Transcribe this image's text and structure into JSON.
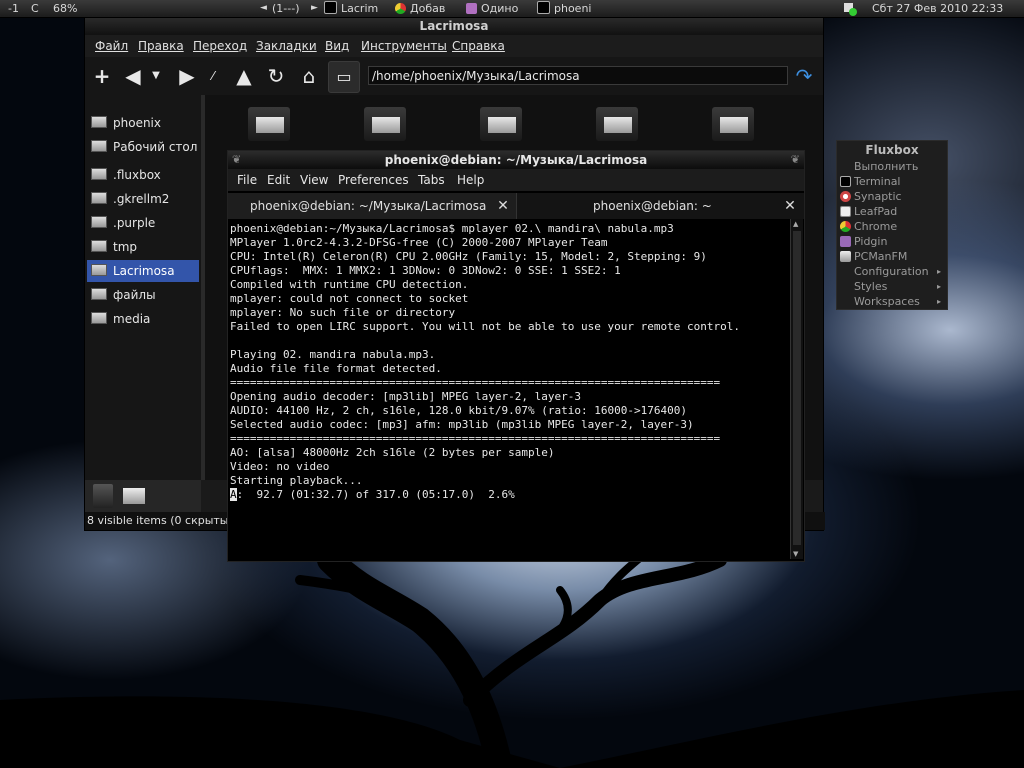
{
  "colors": {
    "selection": "#3355aa",
    "accent": "#3d8fe0",
    "terminal_bg": "#000000"
  },
  "top_panel": {
    "workspace_num": "-1",
    "workspace_letter": "C",
    "cpu_percent": "68%",
    "pager": "(1---)",
    "tasks": [
      "Lacrim",
      "Добав",
      "Одино",
      "phoeni"
    ],
    "clock": "Сбт 27 Фев 2010 22:33"
  },
  "file_manager": {
    "title": "Lacrimosa",
    "menu": [
      "Файл",
      "Правка",
      "Переход",
      "Закладки",
      "Вид",
      "Инструменты",
      "Справка"
    ],
    "toolbar_icons": [
      "new-tab-icon",
      "back-icon",
      "dropdown-icon",
      "forward-icon",
      "up-icon",
      "reload-icon",
      "home-icon",
      "folder-icon",
      "go-icon"
    ],
    "path": "/home/phoenix/Музыка/Lacrimosa",
    "sidebar": [
      {
        "label": "phoenix"
      },
      {
        "label": "Рабочий стол"
      },
      {
        "label": ".fluxbox"
      },
      {
        "label": ".gkrellm2"
      },
      {
        "label": ".purple"
      },
      {
        "label": "tmp"
      },
      {
        "label": "Lacrimosa",
        "selected": true
      },
      {
        "label": "файлы"
      },
      {
        "label": "media"
      }
    ],
    "status": "8 visible items (0 скрыты"
  },
  "terminal": {
    "title": "phoenix@debian: ~/Музыка/Lacrimosa",
    "menu": [
      "File",
      "Edit",
      "View",
      "Preferences",
      "Tabs",
      "Help"
    ],
    "tabs": [
      "phoenix@debian: ~/Музыка/Lacrimosa",
      "phoenix@debian: ~"
    ],
    "lines": [
      "phoenix@debian:~/Музыка/Lacrimosa$ mplayer 02.\\ mandira\\ nabula.mp3",
      "MPlayer 1.0rc2-4.3.2-DFSG-free (C) 2000-2007 MPlayer Team",
      "CPU: Intel(R) Celeron(R) CPU 2.00GHz (Family: 15, Model: 2, Stepping: 9)",
      "CPUflags:  MMX: 1 MMX2: 1 3DNow: 0 3DNow2: 0 SSE: 1 SSE2: 1",
      "Compiled with runtime CPU detection.",
      "mplayer: could not connect to socket",
      "mplayer: No such file or directory",
      "Failed to open LIRC support. You will not be able to use your remote control.",
      "",
      "Playing 02. mandira nabula.mp3.",
      "Audio file file format detected.",
      "==========================================================================",
      "Opening audio decoder: [mp3lib] MPEG layer-2, layer-3",
      "AUDIO: 44100 Hz, 2 ch, s16le, 128.0 kbit/9.07% (ratio: 16000->176400)",
      "Selected audio codec: [mp3] afm: mp3lib (mp3lib MPEG layer-2, layer-3)",
      "==========================================================================",
      "AO: [alsa] 48000Hz 2ch s16le (2 bytes per sample)",
      "Video: no video",
      "Starting playback..."
    ],
    "cursor_char": "A",
    "status_line": ":  92.7 (01:32.7) of 317.0 (05:17.0)  2.6%"
  },
  "fluxbox_menu": {
    "title": "Fluxbox",
    "items": [
      {
        "label": "Выполнить",
        "icon": ""
      },
      {
        "label": "Terminal",
        "icon": "terminal-icon"
      },
      {
        "label": "Synaptic",
        "icon": "synaptic-icon"
      },
      {
        "label": "LeafPad",
        "icon": "leafpad-icon"
      },
      {
        "label": "Chrome",
        "icon": "chrome-icon"
      },
      {
        "label": "Pidgin",
        "icon": "pidgin-icon"
      },
      {
        "label": "PCManFM",
        "icon": "pcmanfm-icon"
      },
      {
        "label": "Configuration",
        "submenu": true
      },
      {
        "label": "Styles",
        "submenu": true
      },
      {
        "label": "Workspaces",
        "submenu": true
      }
    ]
  }
}
